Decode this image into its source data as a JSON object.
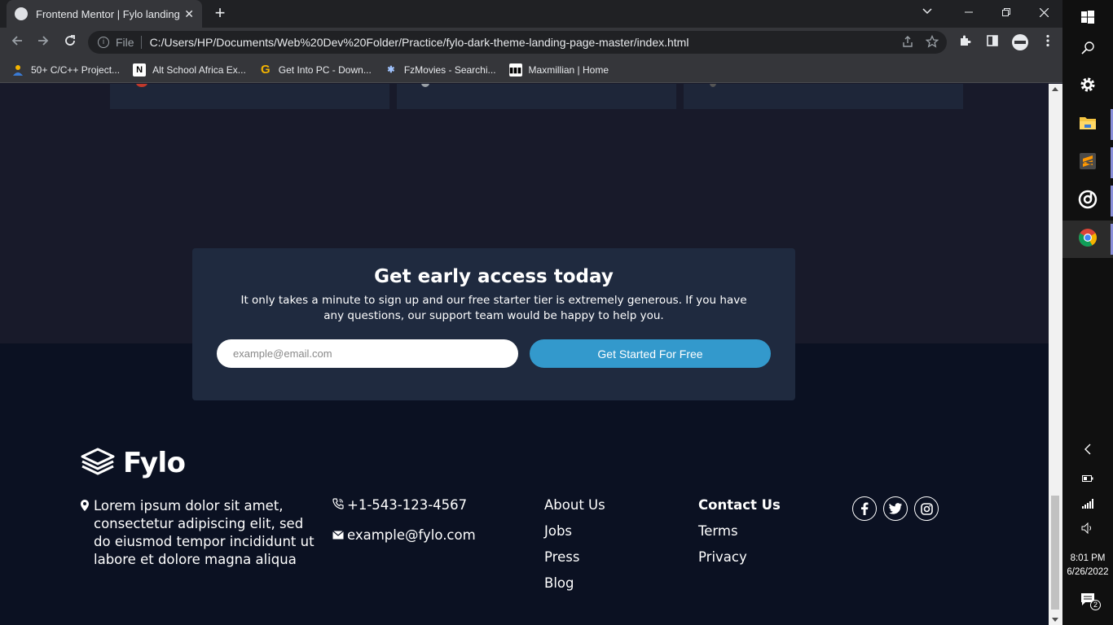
{
  "browser": {
    "tab_title": "Frontend Mentor | Fylo landing p",
    "new_tab": "+",
    "scheme_label": "File",
    "url": "C:/Users/HP/Documents/Web%20Dev%20Folder/Practice/fylo-dark-theme-landing-page-master/index.html",
    "bookmarks": [
      {
        "label": "50+ C/C++ Project...",
        "icon": "user-icon",
        "color": "#3a7bd5"
      },
      {
        "label": "Alt School Africa Ex...",
        "icon": "notion-icon",
        "color": "#ffffff"
      },
      {
        "label": "Get Into PC - Down...",
        "icon": "g-icon",
        "color": "#f4b400"
      },
      {
        "label": "FzMovies - Searchi...",
        "icon": "fz-icon",
        "color": "#a0c4ff"
      },
      {
        "label": "Maxmillian | Home",
        "icon": "max-icon",
        "color": "#ffffff"
      }
    ]
  },
  "cta": {
    "title": "Get early access today",
    "description": "It only takes a minute to sign up and our free starter tier is extremely generous. If you have any questions, our support team would be happy to help you.",
    "email_placeholder": "example@email.com",
    "button_label": "Get Started For Free"
  },
  "footer": {
    "brand": "Fylo",
    "address": "Lorem ipsum dolor sit amet, consectetur adipiscing elit, sed do eiusmod tempor incididunt ut labore et dolore magna aliqua",
    "phone": "+1-543-123-4567",
    "email": "example@fylo.com",
    "links_col1": [
      "About Us",
      "Jobs",
      "Press",
      "Blog"
    ],
    "links_col2": [
      "Contact Us",
      "Terms",
      "Privacy"
    ],
    "social": [
      "facebook-icon",
      "twitter-icon",
      "instagram-icon"
    ]
  },
  "taskbar": {
    "time": "8:01 PM",
    "date": "6/26/2022",
    "notification_count": "2"
  },
  "colors": {
    "page_bg": "#181a2a",
    "footer_bg": "#0b1122",
    "cta_bg": "#1f2a3f",
    "button": "#3399cc"
  }
}
